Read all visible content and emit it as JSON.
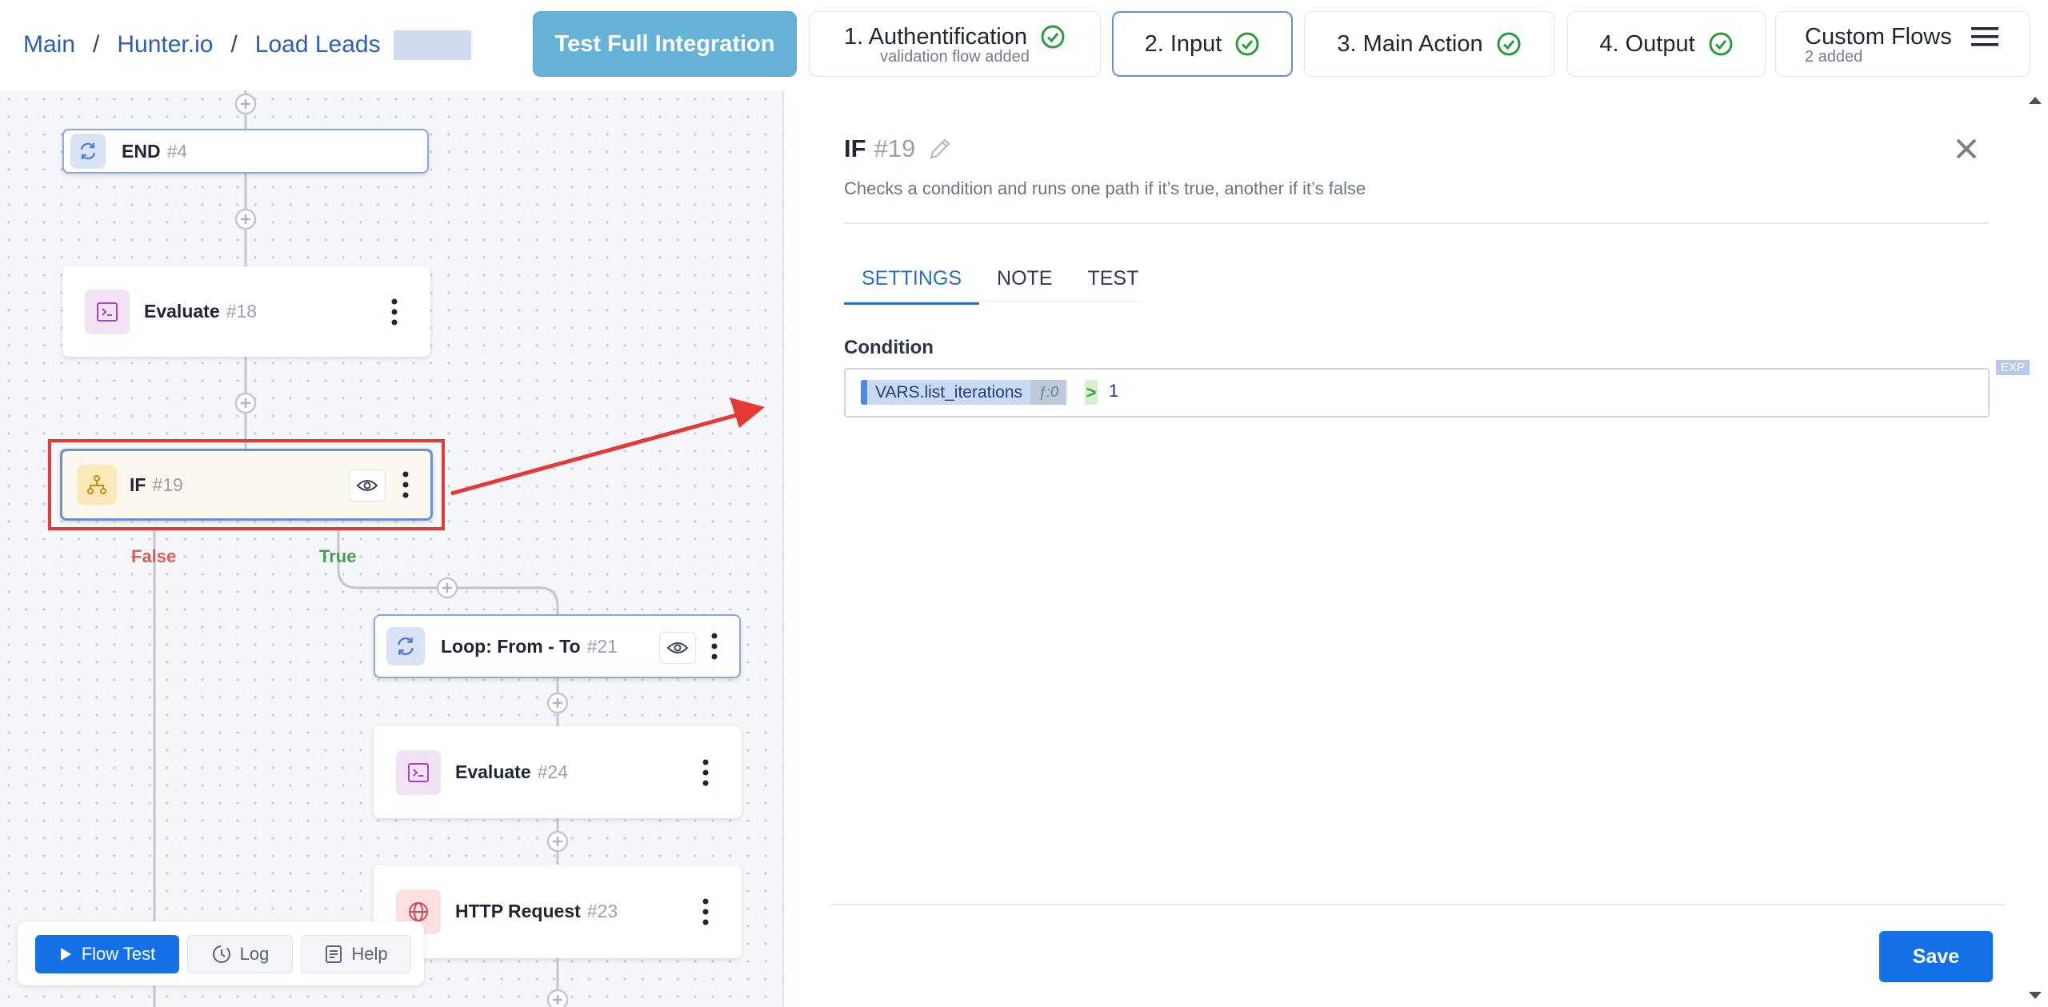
{
  "breadcrumb": {
    "items": [
      "Main",
      "Hunter.io",
      "Load Leads"
    ],
    "separator": "/"
  },
  "nav": {
    "test_full": "Test Full Integration",
    "steps": [
      {
        "label": "1. Authentification",
        "sub": "validation flow added"
      },
      {
        "label": "2. Input"
      },
      {
        "label": "3. Main Action"
      },
      {
        "label": "4. Output"
      }
    ],
    "custom_flows": {
      "label": "Custom Flows",
      "sub": "2 added"
    }
  },
  "canvas": {
    "nodes": [
      {
        "title": "END",
        "id": "#4"
      },
      {
        "title": "Evaluate",
        "id": "#18"
      },
      {
        "title": "IF",
        "id": "#19"
      },
      {
        "title": "Loop: From - To",
        "id": "#21"
      },
      {
        "title": "Evaluate",
        "id": "#24"
      },
      {
        "title": "HTTP Request",
        "id": "#23"
      }
    ],
    "branches": {
      "false": "False",
      "true": "True"
    }
  },
  "bottom": {
    "flow_test": "Flow Test",
    "log": "Log",
    "help": "Help"
  },
  "panel": {
    "title": "IF",
    "id": "#19",
    "description": "Checks a condition and runs one path if it’s true, another if it’s false",
    "tabs": [
      "SETTINGS",
      "NOTE",
      "TEST"
    ],
    "condition_label": "Condition",
    "exp_badge": "EXP",
    "condition": {
      "variable": "VARS.list_iterations",
      "function_tag": "ƒ:0",
      "operator": ">",
      "value": "1"
    },
    "save": "Save"
  },
  "colors": {
    "accent": "#1470e6",
    "link": "#2b5fb0",
    "check": "#2a9d3a",
    "highlight_box": "#e53935",
    "false_label": "#e05a5a",
    "true_label": "#4a9e4a"
  }
}
